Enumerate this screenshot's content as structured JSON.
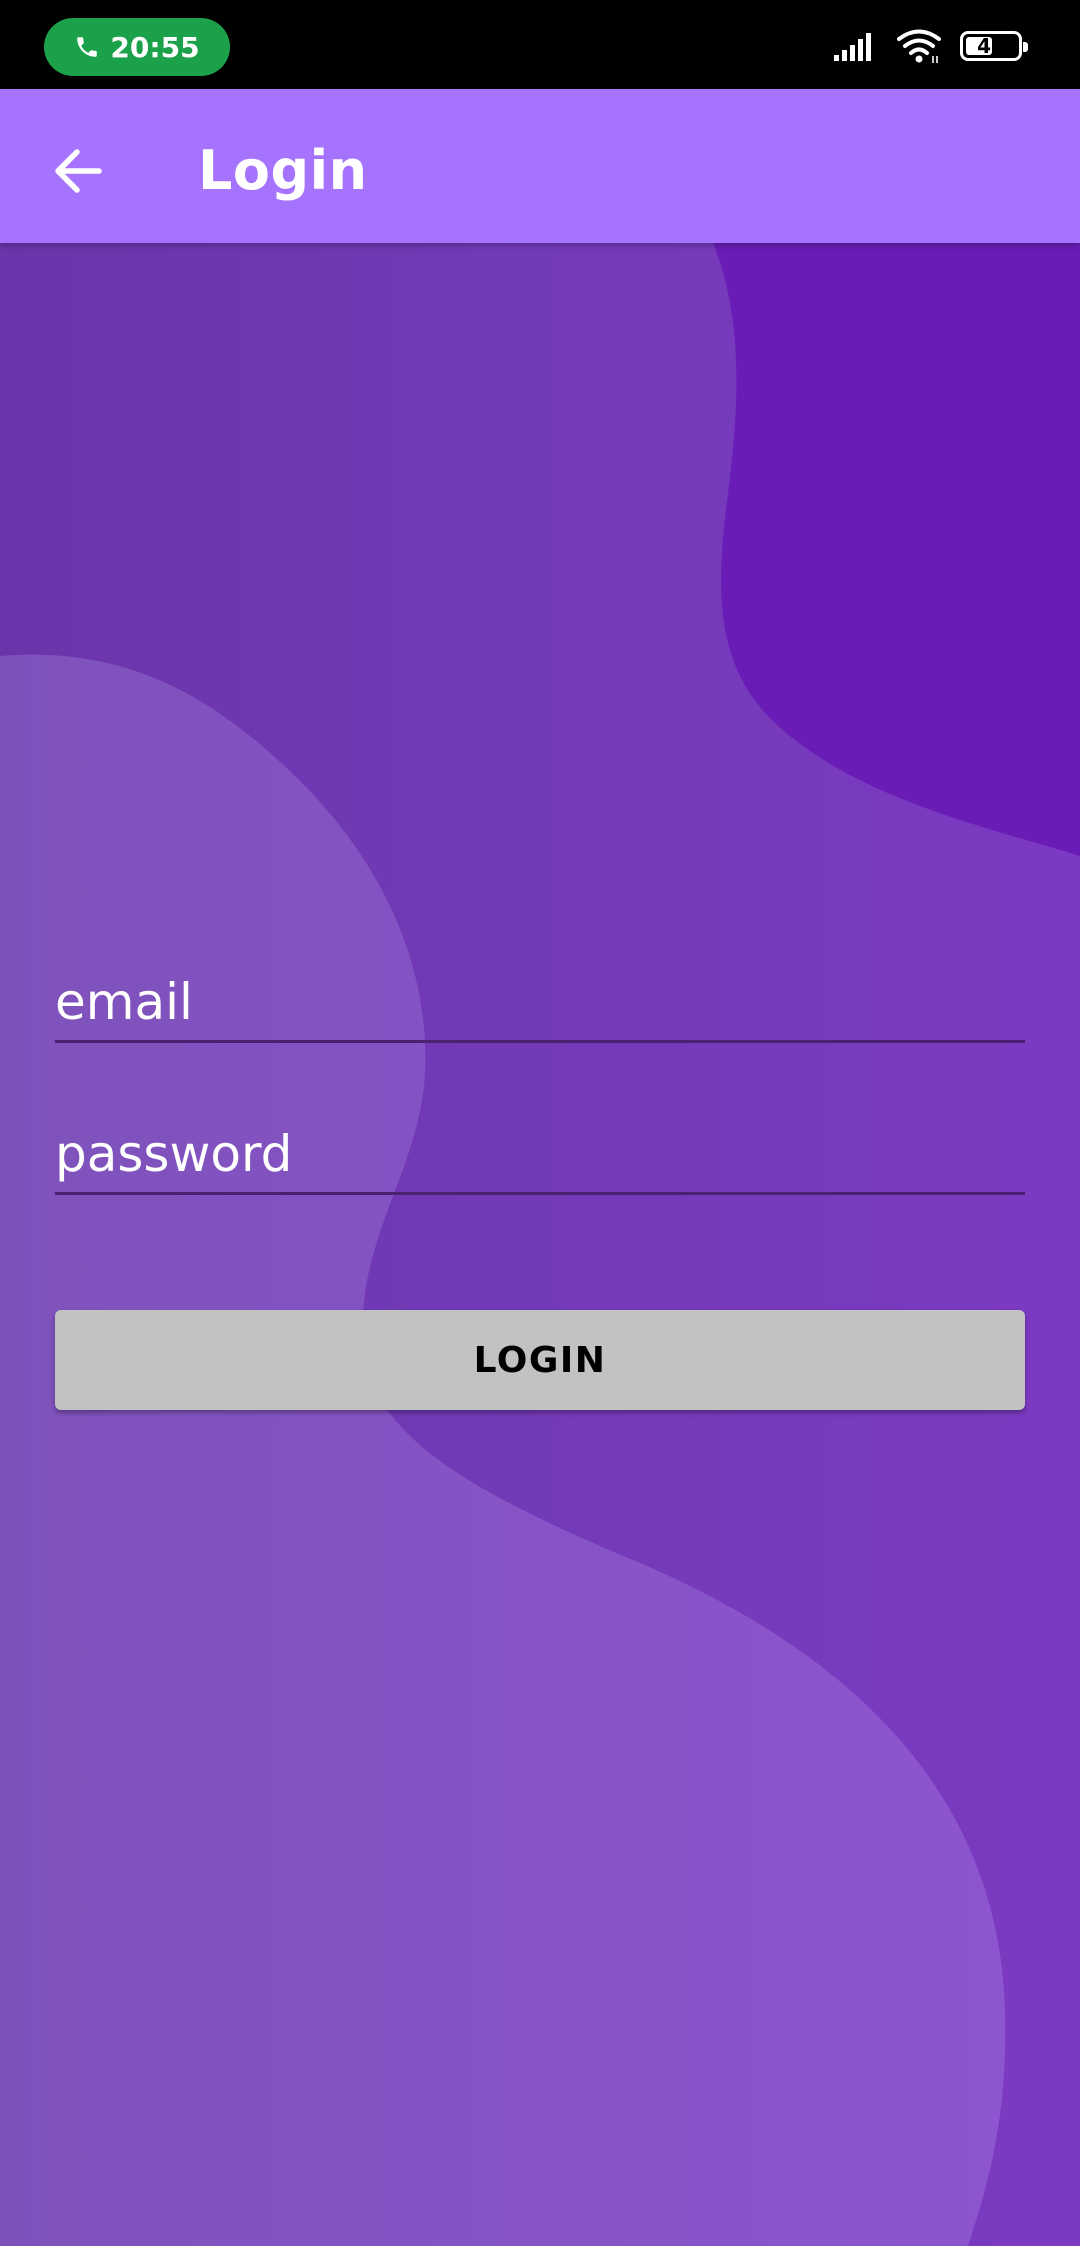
{
  "status_bar": {
    "call_time": "20:55",
    "battery_level": "47",
    "icons": [
      "phone-icon",
      "signal-icon",
      "wifi-icon",
      "battery-icon"
    ]
  },
  "app_bar": {
    "title": "Login",
    "back_icon": "arrow-left-icon"
  },
  "form": {
    "email_placeholder": "email",
    "email_value": "",
    "password_placeholder": "password",
    "password_value": "",
    "login_label": "LOGIN"
  },
  "colors": {
    "status_bar_bg": "#000000",
    "call_pill": "#1aa14a",
    "app_bar": "#a673ff",
    "background": "#733ab8",
    "dark_blob": "#6a1db6",
    "light_blob": "#8a5ac6",
    "button_bg": "#c2c2c2"
  }
}
